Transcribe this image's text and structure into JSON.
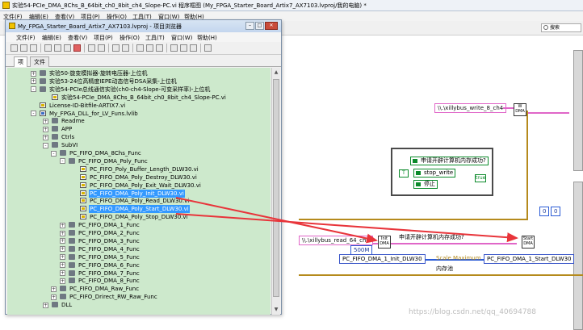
{
  "block_diagram": {
    "title": "实验54-PCIe_DMA_8Chs_B_64bit_ch0_8bit_ch4_Slope-PC.vi 程序框图 (My_FPGA_Starter_Board_Artix7_AX7103.lvproj/我的电脑) *",
    "menu": [
      "文件(F)",
      "编辑(E)",
      "查看(V)",
      "项目(P)",
      "操作(O)",
      "工具(T)",
      "窗口(W)",
      "帮助(H)"
    ],
    "search_placeholder": "搜索",
    "nodes": {
      "write_path": "\\\\.\\xillybus_write_8_ch4",
      "read_path": "\\\\.\\xillybus_read_64_ch0",
      "case_question": "申请开辟计算机内存成功?",
      "stop_write": "stop_write",
      "stop": "停止",
      "true_const": "T",
      "true_small": "true",
      "zero_const_a": "0",
      "zero_const_b": "0",
      "mem_size": "500M",
      "init_dma_icon": "Init DMA",
      "start_dma_icon": "Start DMA",
      "write_dma_icon": "W DMA",
      "mem_question": "申请开辟计算机内存成功?",
      "init_enum": "PC_FIFO_DMA_1_Init_DLW30",
      "scale_label": "Scale.Maximum",
      "start_enum": "PC_FIFO_DMA_1_Start_DLW30",
      "mem_pool": "内存池"
    },
    "watermark": "https://blog.csdn.net/qq_40694788"
  },
  "project_explorer": {
    "title": "My_FPGA_Starter_Board_Artix7_AX7103.lvproj - 项目浏览器",
    "menu": [
      "文件(F)",
      "编辑(E)",
      "查看(V)",
      "项目(P)",
      "操作(O)",
      "工具(T)",
      "窗口(W)",
      "帮助(H)"
    ],
    "tabs": [
      "项",
      "文件"
    ],
    "tree": [
      {
        "label": "实验50-旋变模拟器-旋转电压器-上位机",
        "type": "folder",
        "expander": "+"
      },
      {
        "label": "实验53-24位高精度IEPE动态信号DSA采集-上位机",
        "type": "folder",
        "expander": "+"
      },
      {
        "label": "实验54-PCIe总线通信实验(ch0-ch4-Slope-可变采样率)-上位机",
        "type": "folder",
        "expander": "-"
      },
      {
        "label": "实验54-PCIe_DMA_8Chs_B_64bit_ch0_8bit_ch4_Slope-PC.vi",
        "type": "vi",
        "expander": ""
      },
      {
        "label": "License-ID-Bitfile-ARTIX7.vi",
        "type": "vi",
        "expander": ""
      },
      {
        "label": "My_FPGA_DLL_for_LV_Funs.lvlib",
        "type": "lib",
        "expander": "-"
      },
      {
        "label": "Readme",
        "type": "folder",
        "expander": "+"
      },
      {
        "label": "APP",
        "type": "folder",
        "expander": "+"
      },
      {
        "label": "Ctrls",
        "type": "folder",
        "expander": "+"
      },
      {
        "label": "SubVI",
        "type": "folder",
        "expander": "-"
      },
      {
        "label": "PC_FIFO_DMA_8Chs_Func",
        "type": "folder",
        "expander": "-"
      },
      {
        "label": "PC_FIFO_DMA_Poly_Func",
        "type": "folder",
        "expander": "-"
      },
      {
        "label": "PC_FIFO_Poly_Buffer_Length_DLW30.vi",
        "type": "vi",
        "expander": ""
      },
      {
        "label": "PC_FIFO_DMA_Poly_Destroy_DLW30.vi",
        "type": "vi",
        "expander": ""
      },
      {
        "label": "PC_FIFO_DMA_Poly_Exit_Wait_DLW30.vi",
        "type": "vi",
        "expander": ""
      },
      {
        "label": "PC_FIFO_DMA_Poly_Init_DLW30.vi",
        "type": "vi",
        "expander": "",
        "selected": true
      },
      {
        "label": "PC_FIFO_DMA_Poly_Read_DLW30.vi",
        "type": "vi",
        "expander": ""
      },
      {
        "label": "PC_FIFO_DMA_Poly_Start_DLW30.vi",
        "type": "vi",
        "expander": "",
        "selected": true
      },
      {
        "label": "PC_FIFO_DMA_Poly_Stop_DLW30.vi",
        "type": "vi",
        "expander": ""
      },
      {
        "label": "PC_FIFO_DMA_1_Func",
        "type": "folder",
        "expander": "+"
      },
      {
        "label": "PC_FIFO_DMA_2_Func",
        "type": "folder",
        "expander": "+"
      },
      {
        "label": "PC_FIFO_DMA_3_Func",
        "type": "folder",
        "expander": "+"
      },
      {
        "label": "PC_FIFO_DMA_4_Func",
        "type": "folder",
        "expander": "+"
      },
      {
        "label": "PC_FIFO_DMA_5_Func",
        "type": "folder",
        "expander": "+"
      },
      {
        "label": "PC_FIFO_DMA_6_Func",
        "type": "folder",
        "expander": "+"
      },
      {
        "label": "PC_FIFO_DMA_7_Func",
        "type": "folder",
        "expander": "+"
      },
      {
        "label": "PC_FIFO_DMA_8_Func",
        "type": "folder",
        "expander": "+"
      },
      {
        "label": "PC_FIFO_DMA_Raw_Func",
        "type": "folder",
        "expander": "+"
      },
      {
        "label": "PC_FIFO_Drirect_RW_Raw_Func",
        "type": "folder",
        "expander": "+"
      },
      {
        "label": "DLL",
        "type": "folder",
        "expander": "+"
      }
    ]
  },
  "colors": {
    "tree_bg": "#cde9cc",
    "selection": "#3399ff",
    "arrow": "#e8343a",
    "string_wire": "#e066c8",
    "numeric_wire": "#b58a1c",
    "enum_wire": "#2a5bd6"
  }
}
